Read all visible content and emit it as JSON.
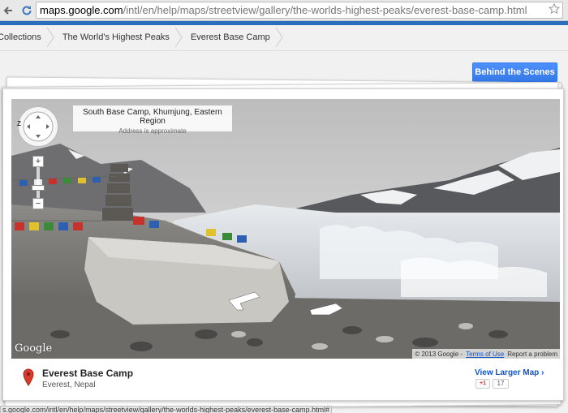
{
  "browser": {
    "url_host": "maps.google.com",
    "url_path": "/intl/en/help/maps/streetview/gallery/the-worlds-highest-peaks/everest-base-camp.html",
    "status_url": "s.google.com/intl/en/help/maps/streetview/gallery/the-worlds-highest-peaks/everest-base-camp.html#"
  },
  "breadcrumbs": [
    "Collections",
    "The World's Highest Peaks",
    "Everest Base Camp"
  ],
  "behind_button": "Behind the Scenes",
  "streetview": {
    "address_title": "South Base Camp, Khumjung, Eastern Region",
    "address_note": "Address is approximate",
    "compass_label": "Z",
    "zoom_in": "+",
    "zoom_out": "−",
    "logo": "Google",
    "copyright": "© 2013 Google -",
    "terms": "Terms of Use",
    "report": "Report a problem"
  },
  "place": {
    "name": "Everest Base Camp",
    "location": "Everest, Nepal",
    "larger_map": "View Larger Map ›",
    "plus_one_label": "+1",
    "plus_one_count": "17"
  },
  "colors": {
    "accent_blue": "#4d90fe",
    "link_blue": "#1155cc",
    "pin_red": "#d93a2b"
  },
  "icons": [
    "back-arrow-icon",
    "reload-icon",
    "star-icon",
    "compass-icon",
    "map-pin-icon"
  ]
}
